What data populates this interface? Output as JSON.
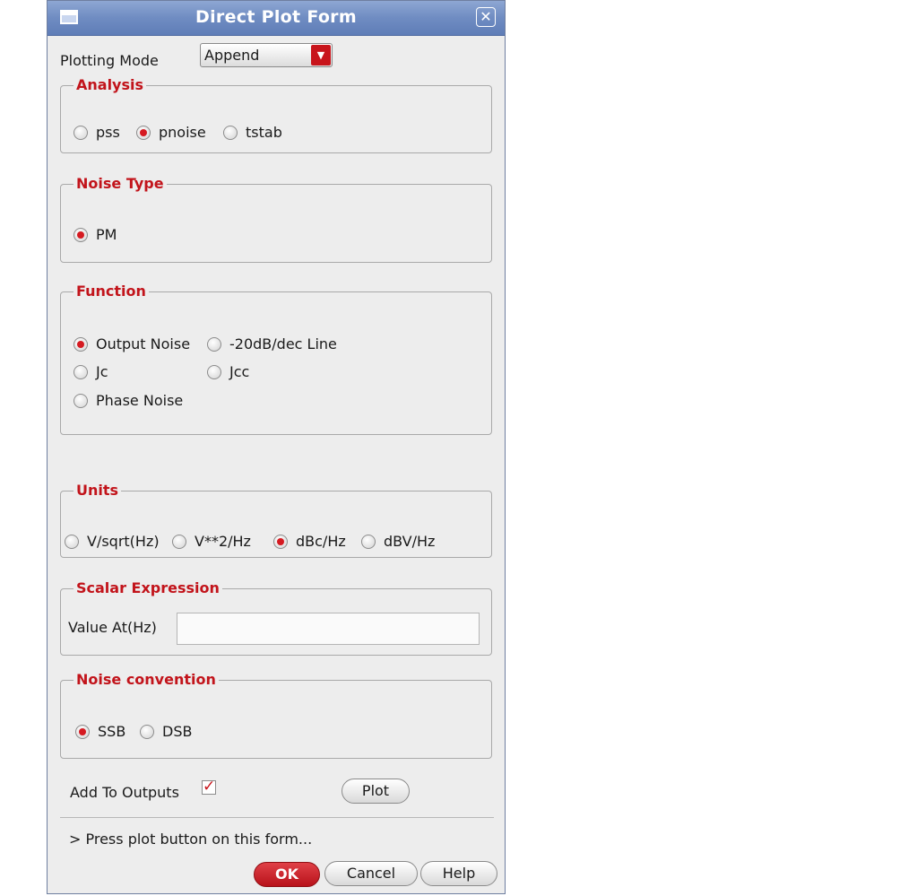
{
  "window": {
    "title": "Direct Plot Form"
  },
  "plotting_mode": {
    "label": "Plotting Mode",
    "value": "Append"
  },
  "analysis": {
    "title": "Analysis",
    "options": [
      {
        "label": "pss",
        "selected": false
      },
      {
        "label": "pnoise",
        "selected": true
      },
      {
        "label": "tstab",
        "selected": false
      }
    ]
  },
  "noise_type": {
    "title": "Noise Type",
    "options": [
      {
        "label": "PM",
        "selected": true
      }
    ]
  },
  "function": {
    "title": "Function",
    "options": [
      {
        "label": "Output Noise",
        "selected": true
      },
      {
        "label": "-20dB/dec Line",
        "selected": false
      },
      {
        "label": "Jc",
        "selected": false
      },
      {
        "label": "Jcc",
        "selected": false
      },
      {
        "label": "Phase Noise",
        "selected": false
      }
    ]
  },
  "units": {
    "title": "Units",
    "options": [
      {
        "label": "V/sqrt(Hz)",
        "selected": false
      },
      {
        "label": "V**2/Hz",
        "selected": false
      },
      {
        "label": "dBc/Hz",
        "selected": true
      },
      {
        "label": "dBV/Hz",
        "selected": false
      }
    ]
  },
  "scalar_expression": {
    "title": "Scalar Expression",
    "label": "Value At(Hz)",
    "value": ""
  },
  "noise_convention": {
    "title": "Noise convention",
    "options": [
      {
        "label": "SSB",
        "selected": true
      },
      {
        "label": "DSB",
        "selected": false
      }
    ]
  },
  "add_to_outputs": {
    "label": "Add To Outputs",
    "checked": true
  },
  "buttons": {
    "plot": "Plot",
    "ok": "OK",
    "cancel": "Cancel",
    "help": "Help"
  },
  "status": {
    "message": "> Press plot button on this form..."
  },
  "colors": {
    "accent": "#c2141b",
    "titlebar": "#6f8cc2",
    "background": "#ededed"
  }
}
